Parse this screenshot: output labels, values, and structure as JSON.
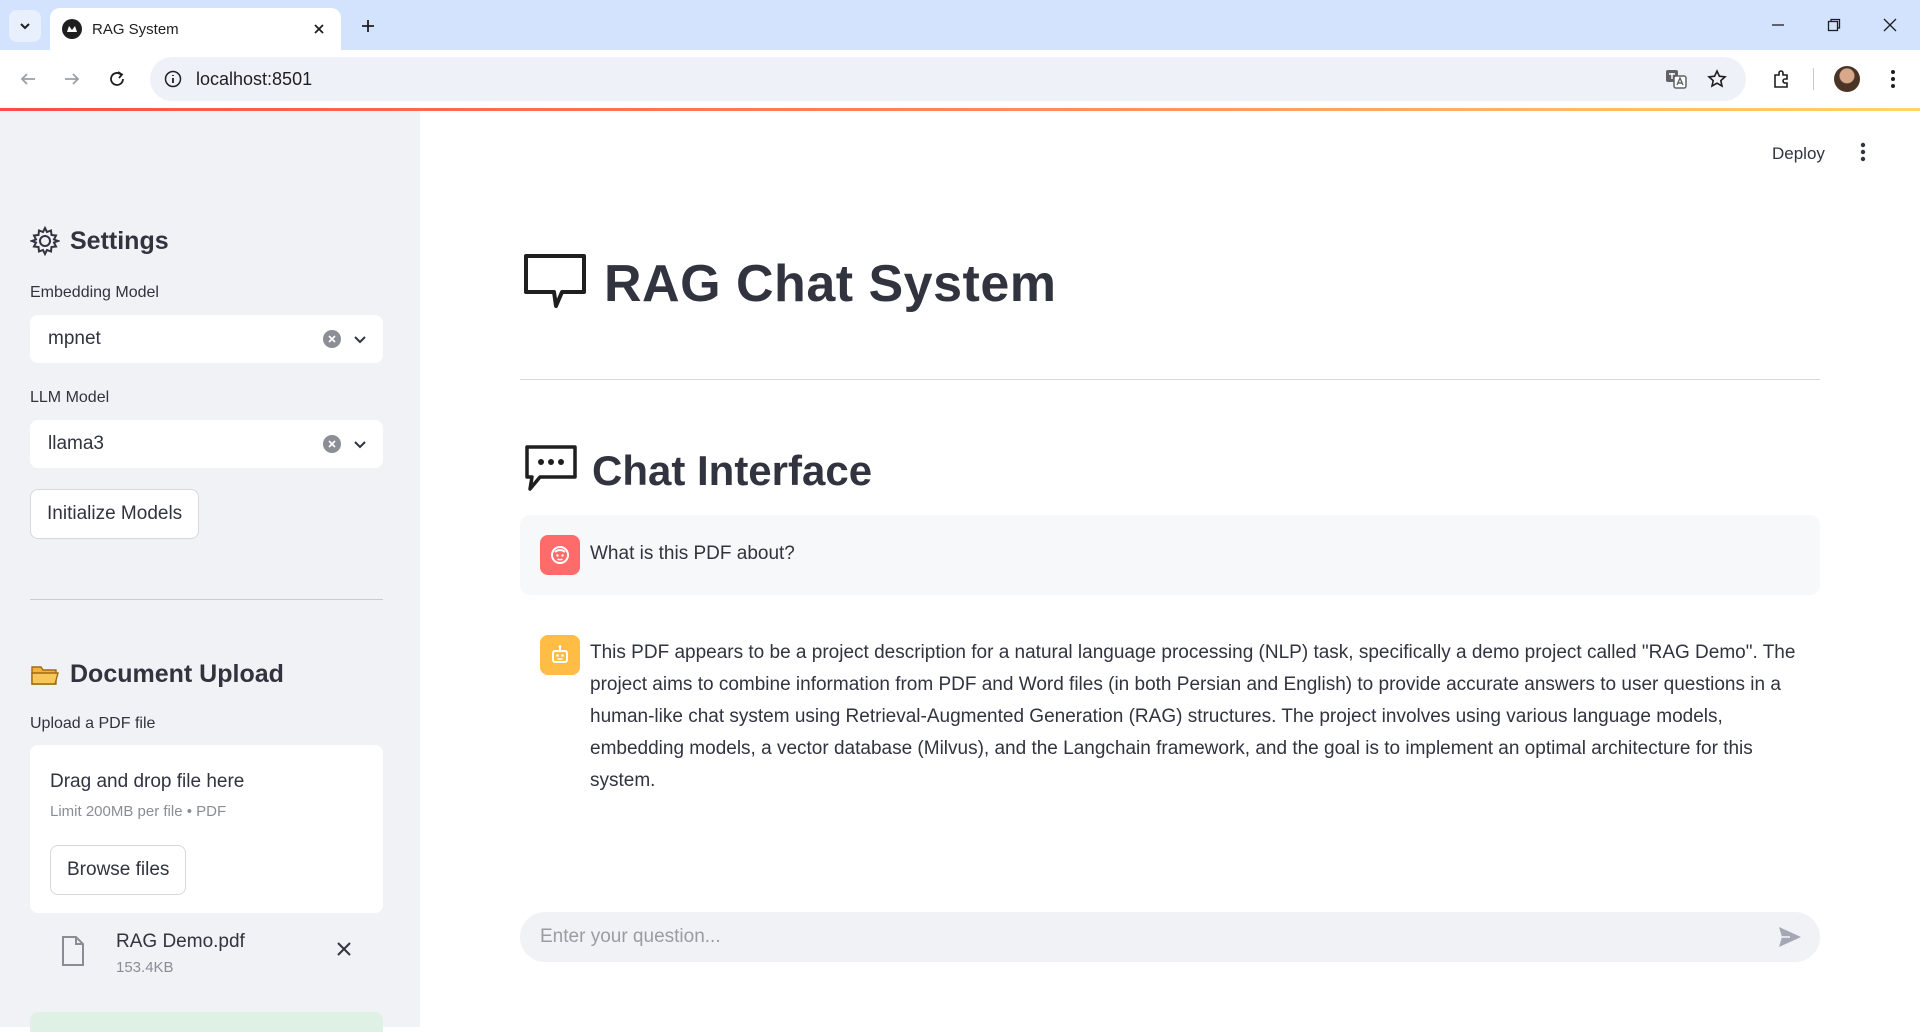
{
  "browser": {
    "tab_title": "RAG System",
    "url": "localhost:8501"
  },
  "header": {
    "deploy_label": "Deploy"
  },
  "sidebar": {
    "settings_title": "Settings",
    "embedding_label": "Embedding Model",
    "embedding_value": "mpnet",
    "llm_label": "LLM Model",
    "llm_value": "llama3",
    "init_button": "Initialize Models",
    "upload_title": "Document Upload",
    "upload_label": "Upload a PDF file",
    "dropzone_text": "Drag and drop file here",
    "dropzone_limit": "Limit 200MB per file • PDF",
    "browse_button": "Browse files",
    "file_name": "RAG Demo.pdf",
    "file_size": "153.4KB"
  },
  "main": {
    "title": "RAG Chat System",
    "chat_heading": "Chat Interface",
    "messages": [
      {
        "role": "user",
        "text": "What is this PDF about?"
      },
      {
        "role": "assistant",
        "text": "This PDF appears to be a project description for a natural language processing (NLP) task, specifically a demo project called \"RAG Demo\". The project aims to combine information from PDF and Word files (in both Persian and English) to provide accurate answers to user questions in a human-like chat system using Retrieval-Augmented Generation (RAG) structures. The project involves using various language models, embedding models, a vector database (Milvus), and the Langchain framework, and the goal is to implement an optimal architecture for this system."
      }
    ],
    "input_placeholder": "Enter your question..."
  },
  "colors": {
    "user_avatar": "#ff6b6b",
    "assistant_avatar": "#ffbd45",
    "sidebar_bg": "#f0f2f6",
    "tabbar_bg": "#d3e3fd"
  },
  "icons": [
    "gear-icon",
    "folder-icon",
    "speech-bubble-icon",
    "chat-dots-icon",
    "user-avatar-icon",
    "robot-icon",
    "send-icon",
    "file-icon",
    "close-icon",
    "chevron-down-icon",
    "clear-icon"
  ]
}
